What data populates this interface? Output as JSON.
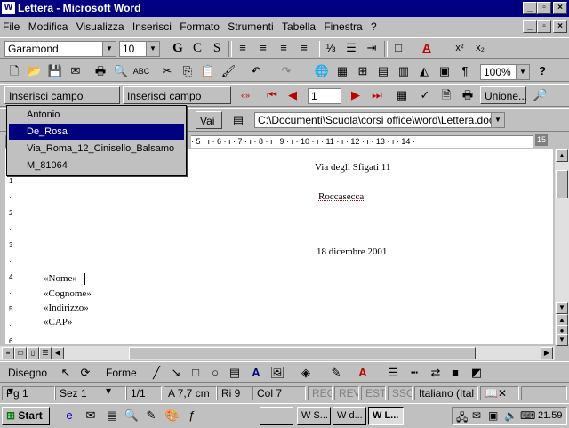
{
  "window": {
    "title": "Lettera - Microsoft Word",
    "app_icon": "W"
  },
  "menu": [
    "File",
    "Modifica",
    "Visualizza",
    "Inserisci",
    "Formato",
    "Strumenti",
    "Tabella",
    "Finestra",
    "?"
  ],
  "format_toolbar": {
    "font": "Garamond",
    "size": "10",
    "bold": "G",
    "italic": "C",
    "underline": "S"
  },
  "standard_toolbar": {
    "zoom": "100%"
  },
  "mailmerge_toolbar": {
    "insert_field": "Inserisci campo unione",
    "insert_word_field": "Inserisci campo Word",
    "record": "1",
    "merge_button": "Unione..."
  },
  "web_toolbar": {
    "go": "Vai",
    "address": "C:\\Documenti\\Scuola\\corsi office\\word\\Lettera.doc"
  },
  "field_dropdown": {
    "items": [
      "Antonio",
      "De_Rosa",
      "Via_Roma_12_Cinisello_Balsamo",
      "M_81064"
    ],
    "selected_index": 1
  },
  "ruler": {
    "marks": "· 5 · ı · 6 · ı · 7 · ı · 8 · ı · 9 · ı · 10 · ı · 11 · ı · 12 · ı · 13 · ı · 14 ·",
    "right_label": "15"
  },
  "document": {
    "line1": "Via degli Sfigati 11",
    "line2": "Roccasecca",
    "date": "18 dicembre 2001",
    "fields": [
      "«Nome»",
      "«Cognome»",
      "«Indirizzo»",
      "«CAP»"
    ]
  },
  "drawing_toolbar": {
    "draw": "Disegno",
    "shapes": "Forme"
  },
  "status": {
    "page": "Pg 1",
    "section": "Sez 1",
    "pages": "1/1",
    "at": "A 7,7 cm",
    "line": "Ri 9",
    "col": "Col 7",
    "reg": "REG",
    "rev": "REV",
    "est": "EST",
    "ssc": "SSC",
    "lang": "Italiano (Ital"
  },
  "taskbar": {
    "start": "Start",
    "tasks": [
      "S...",
      "d...",
      "L..."
    ],
    "clock": "21.59"
  },
  "colors": {
    "titlebar": "#000080",
    "selection": "#000080",
    "face": "#c0c0c0"
  }
}
